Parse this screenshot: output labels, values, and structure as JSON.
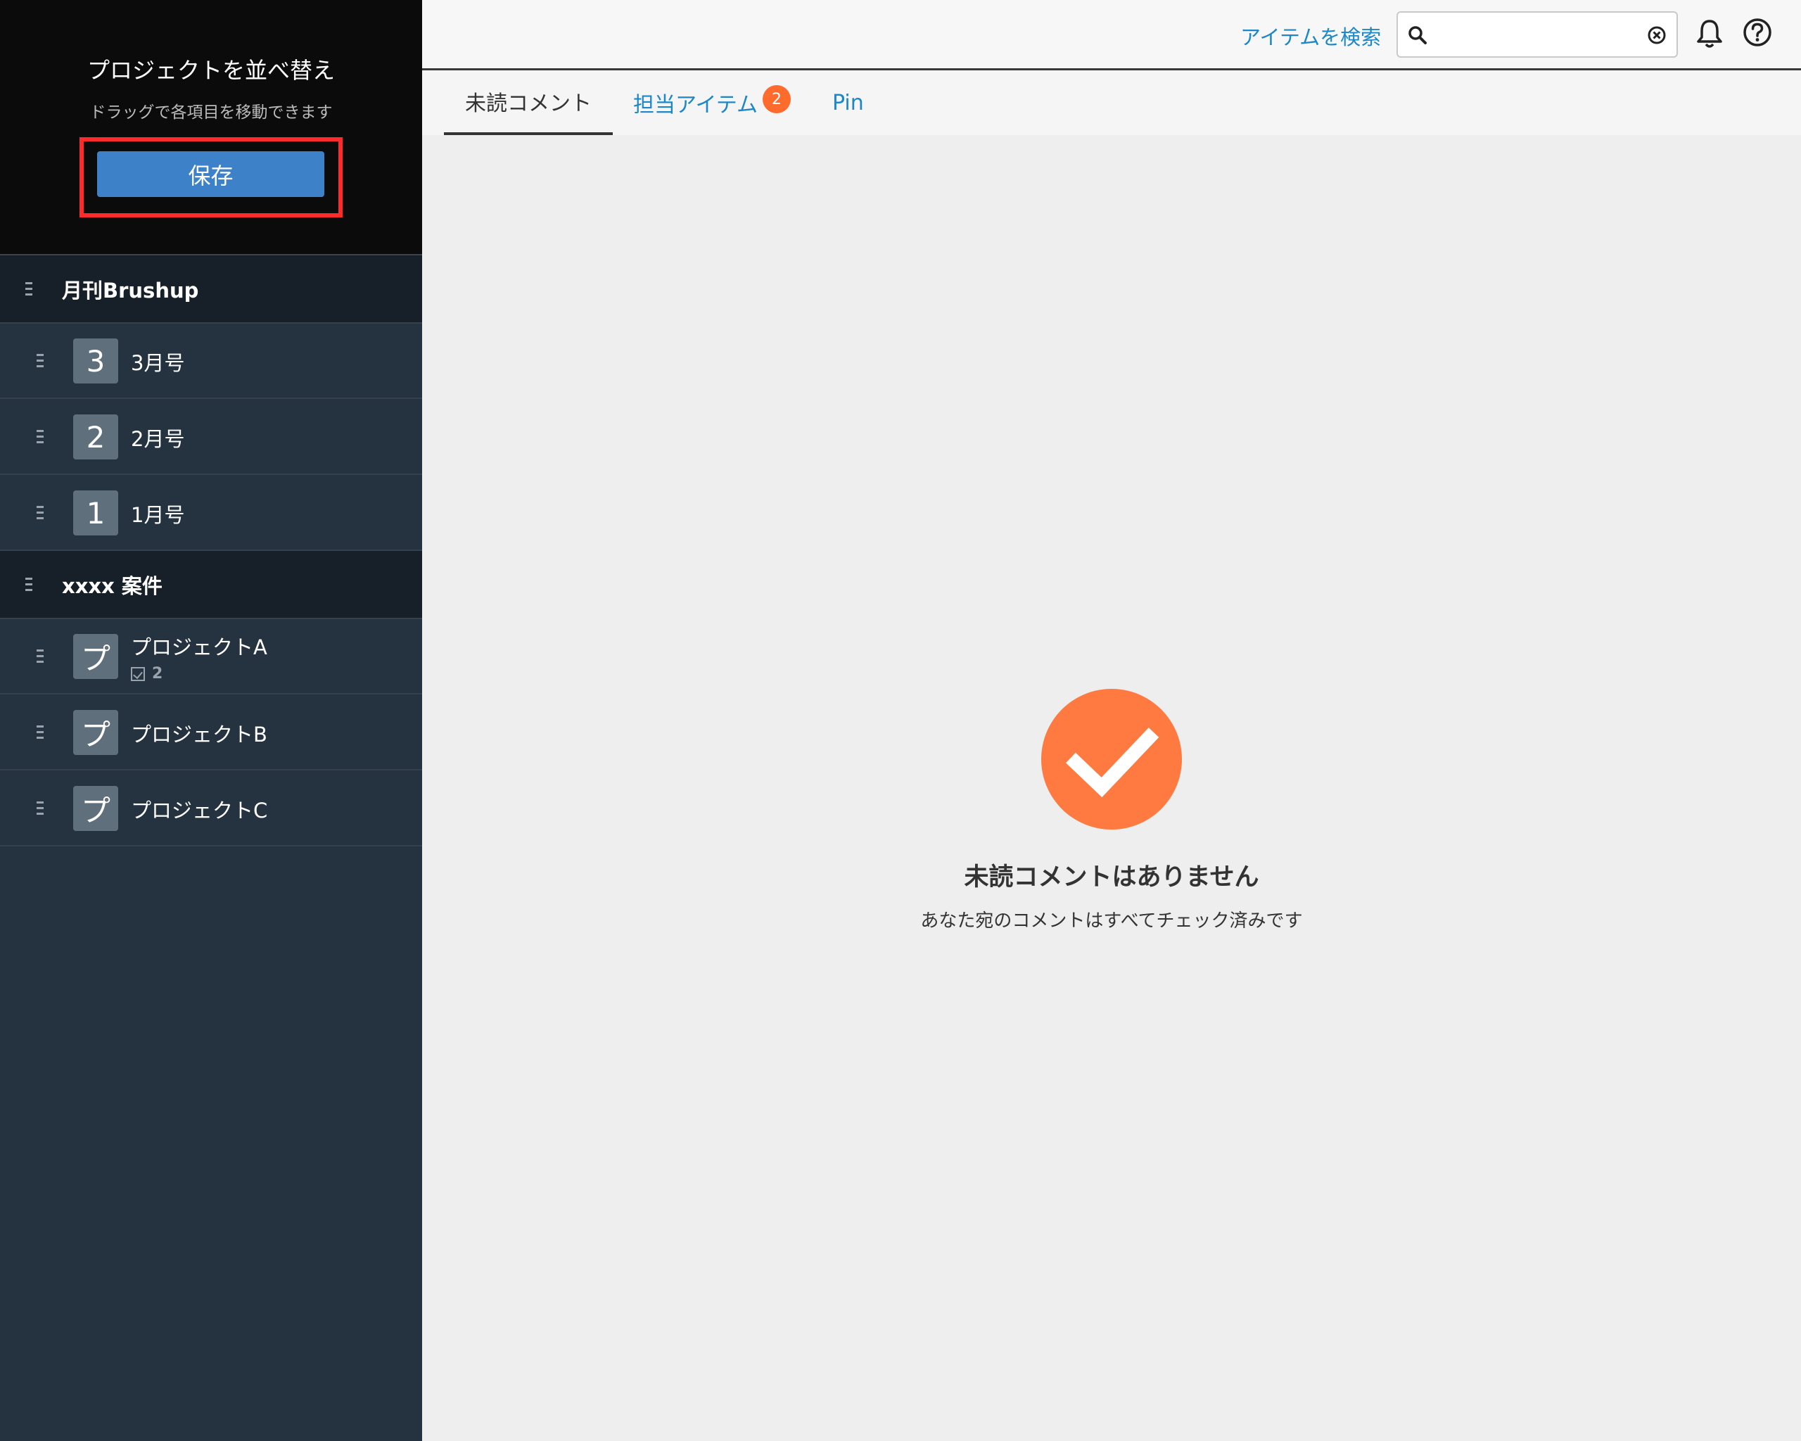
{
  "sidebar": {
    "title": "プロジェクトを並べ替え",
    "subtitle": "ドラッグで各項目を移動できます",
    "save_label": "保存",
    "groups": [
      {
        "label": "月刊Brushup",
        "projects": [
          {
            "icon_char": "3",
            "label": "3月号"
          },
          {
            "icon_char": "2",
            "label": "2月号"
          },
          {
            "icon_char": "1",
            "label": "1月号"
          }
        ]
      },
      {
        "label": "xxxx 案件",
        "projects": [
          {
            "icon_char": "プ",
            "label": "プロジェクトA",
            "task_count": "2"
          },
          {
            "icon_char": "プ",
            "label": "プロジェクトB"
          },
          {
            "icon_char": "プ",
            "label": "プロジェクトC"
          }
        ]
      }
    ]
  },
  "header": {
    "search_link": "アイテムを検索",
    "search_value": "",
    "icons": [
      "search-icon",
      "clear-icon",
      "bell-icon",
      "help-icon"
    ]
  },
  "tabs": [
    {
      "label": "未読コメント",
      "active": true
    },
    {
      "label": "担当アイテム",
      "badge": "2"
    },
    {
      "label": "Pin"
    }
  ],
  "empty_state": {
    "title": "未読コメントはありません",
    "subtitle": "あなた宛のコメントはすべてチェック済みです"
  },
  "colors": {
    "accent": "#1d87c8",
    "save_button": "#3d82c8",
    "highlight_frame": "#ff2a2a",
    "badge": "#ff6b2c",
    "empty_icon": "#ff7a40",
    "sidebar_bg": "#253240"
  }
}
